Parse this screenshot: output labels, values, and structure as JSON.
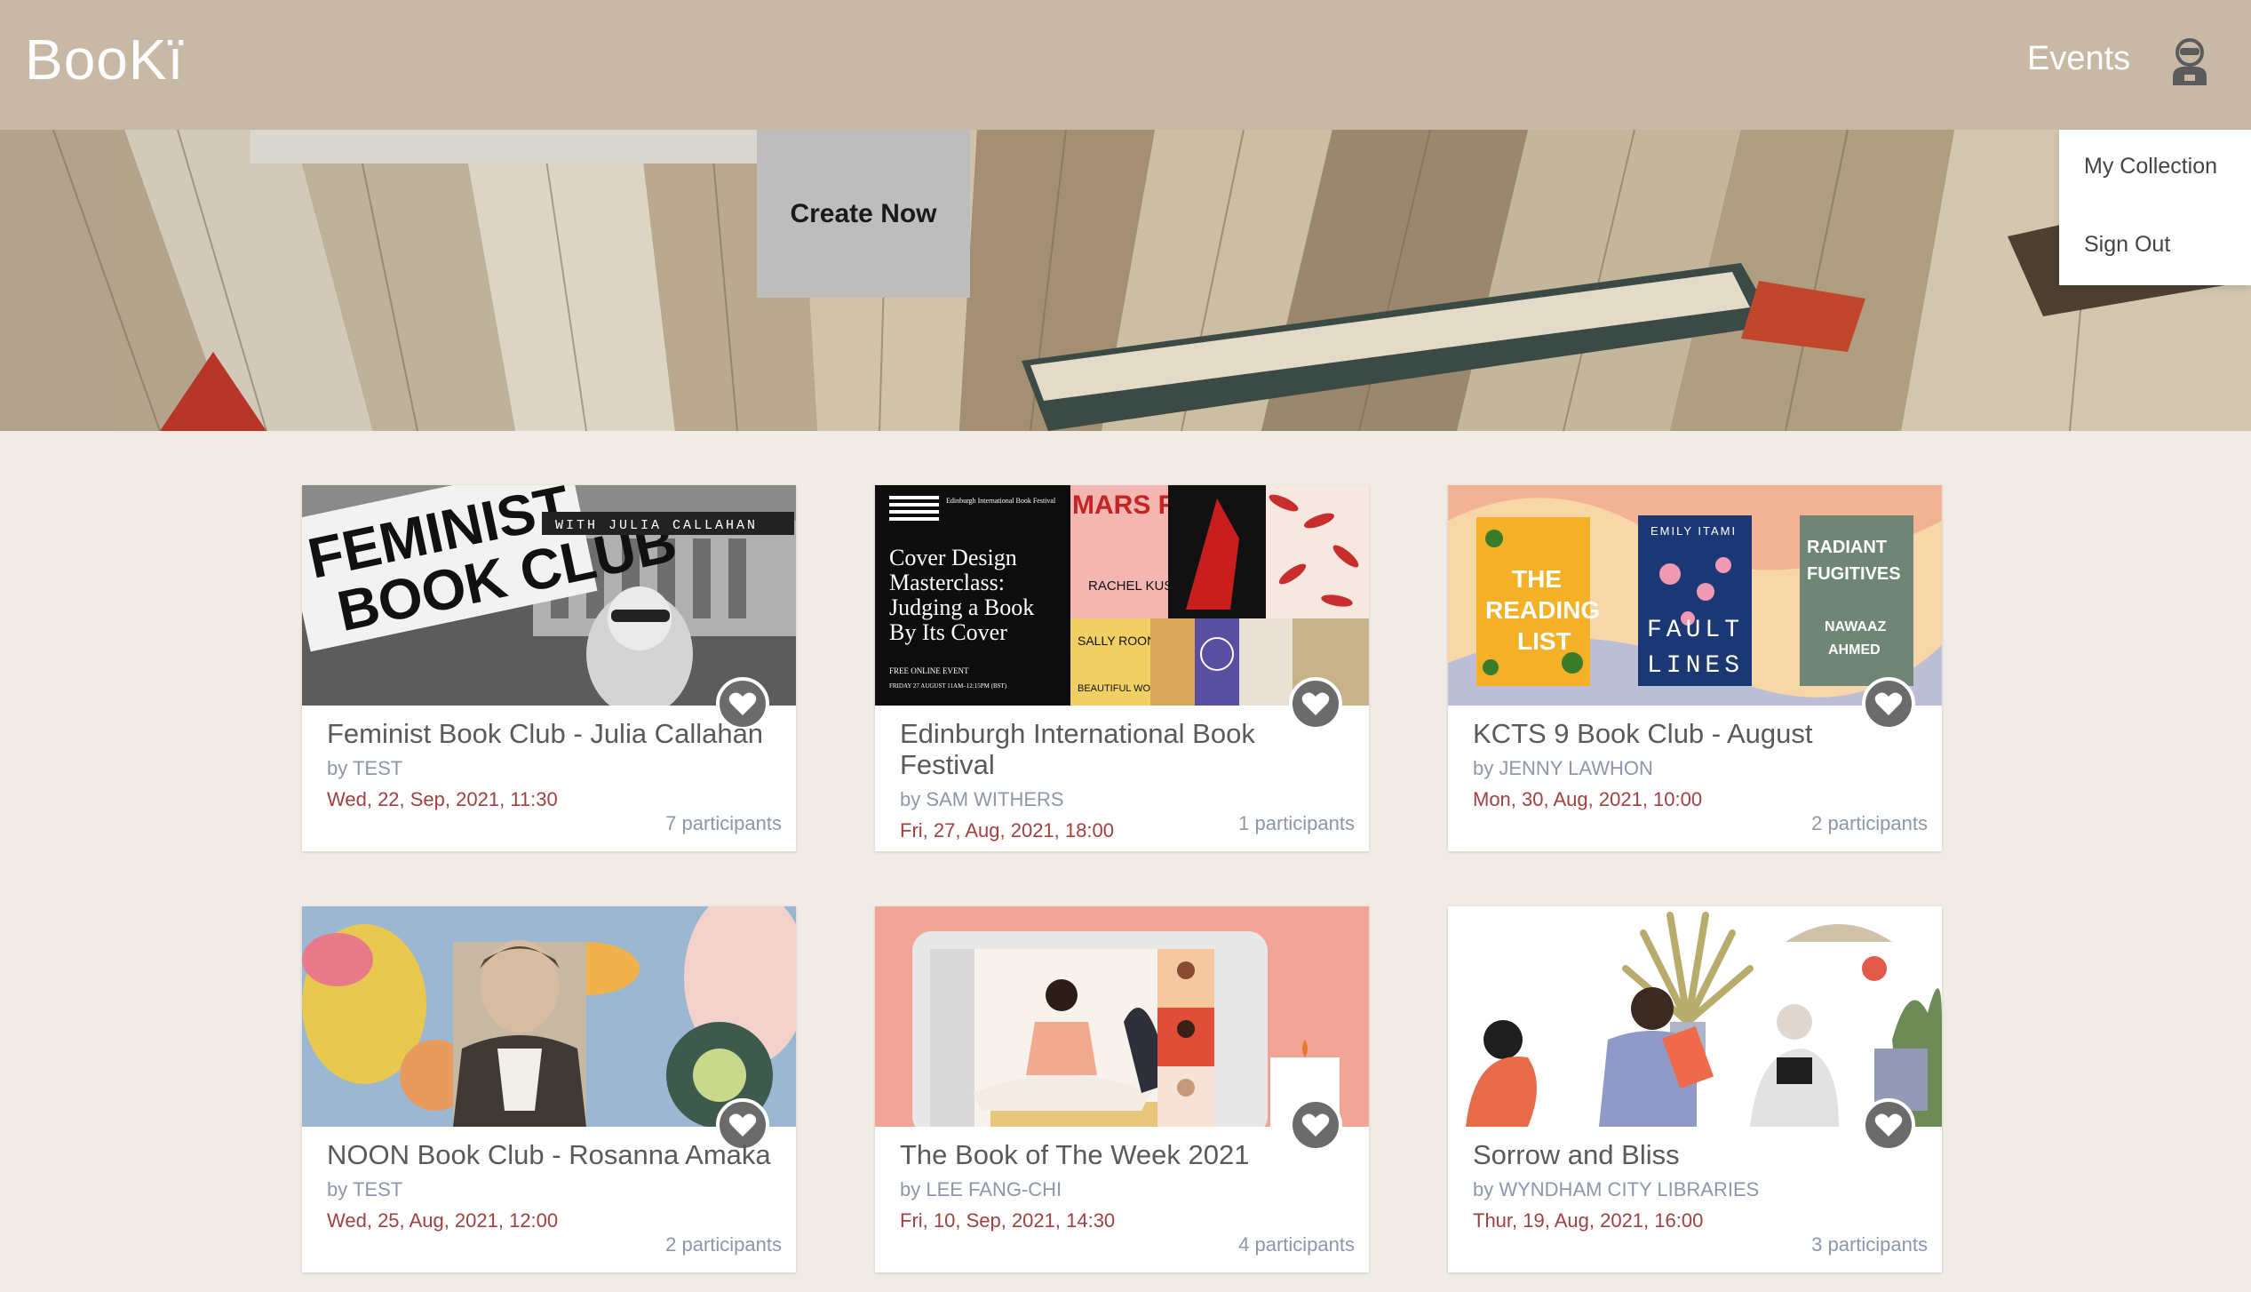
{
  "navbar": {
    "logo": "BooKï",
    "events_label": "Events"
  },
  "hero": {
    "create_label": "Create Now"
  },
  "user_menu": {
    "items": [
      "My Collection",
      "Sign Out"
    ]
  },
  "cards": [
    {
      "title": "Feminist Book Club - Julia Callahan",
      "by": "by TEST",
      "date": "Wed, 22, Sep, 2021, 11:30",
      "participants": "7 participants"
    },
    {
      "title": "Edinburgh International Book Festival",
      "by": "by SAM WITHERS",
      "date": "Fri, 27, Aug, 2021, 18:00",
      "participants": "1 participants"
    },
    {
      "title": "KCTS 9 Book Club - August",
      "by": "by JENNY LAWHON",
      "date": "Mon, 30, Aug, 2021, 10:00",
      "participants": "2 participants"
    },
    {
      "title": "NOON Book Club - Rosanna Amaka",
      "by": "by TEST",
      "date": "Wed, 25, Aug, 2021, 12:00",
      "participants": "2 participants"
    },
    {
      "title": "The Book of The Week 2021",
      "by": "by LEE FANG-CHI",
      "date": "Fri, 10, Sep, 2021, 14:30",
      "participants": "4 participants"
    },
    {
      "title": "Sorrow and Bliss",
      "by": "by WYNDHAM CITY LIBRARIES",
      "date": "Thur, 19, Aug, 2021, 16:00",
      "participants": "3 participants"
    }
  ],
  "images": {
    "card1": {
      "line1": "FEMINIST",
      "line2": "BOOK CLUB",
      "strip": "WITH JULIA CALLAHAN"
    },
    "card2": {
      "header": "Edinburgh International Book Festival",
      "title_lines": [
        "Cover Design",
        "Masterclass:",
        "Judging a Book",
        "By Its Cover"
      ],
      "event_type": "FREE ONLINE EVENT",
      "event_time": "FRIDAY 27 AUGUST 11AM–12:15PM (BST)",
      "book1": "MARS ROOM",
      "book1_author": "RACHEL KUSHNER",
      "book2_author": "SALLY ROONEY",
      "book2": "BEAUTIFUL WORLD"
    },
    "card3": {
      "book1": "THE READING LIST",
      "book2_author": "EMILY ITAMI",
      "book2": "FAULT LINES",
      "book3": "RADIANT FUGITIVES",
      "book3_author": "NAWAAZ AHMED"
    }
  }
}
